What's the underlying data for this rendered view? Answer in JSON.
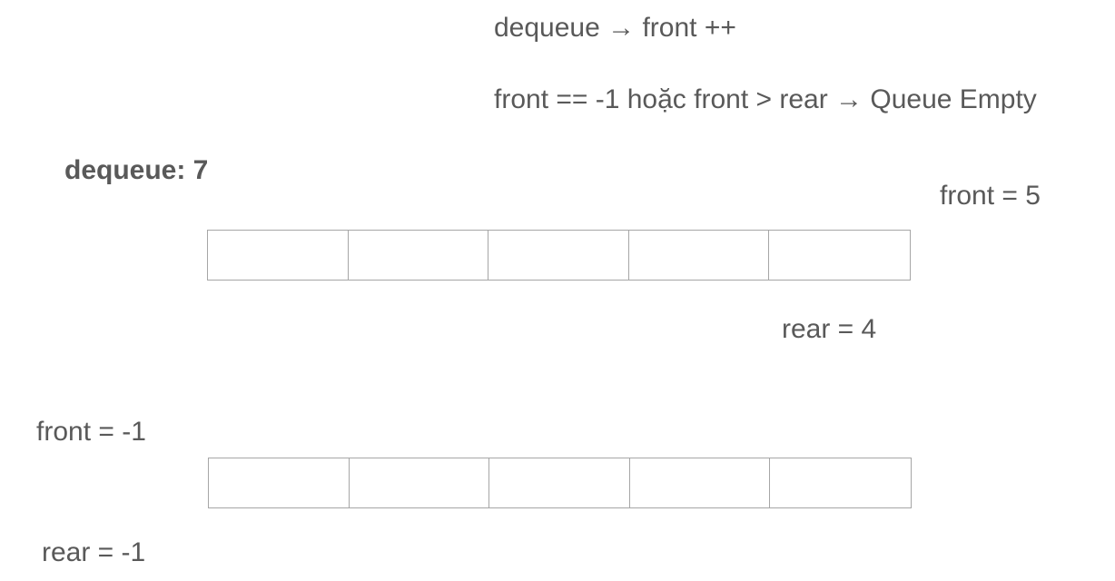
{
  "notes": {
    "dequeue_rule": "dequeue → front ++",
    "empty_rule": "front == -1 hoặc front > rear → Queue Empty"
  },
  "example_top": {
    "title": "dequeue: 7",
    "front_label": "front = 5",
    "rear_label": "rear = 4",
    "cells": [
      "",
      "",
      "",
      "",
      ""
    ]
  },
  "example_bottom": {
    "front_label": "front = -1",
    "rear_label": "rear = -1",
    "cells": [
      "",
      "",
      "",
      "",
      ""
    ]
  }
}
